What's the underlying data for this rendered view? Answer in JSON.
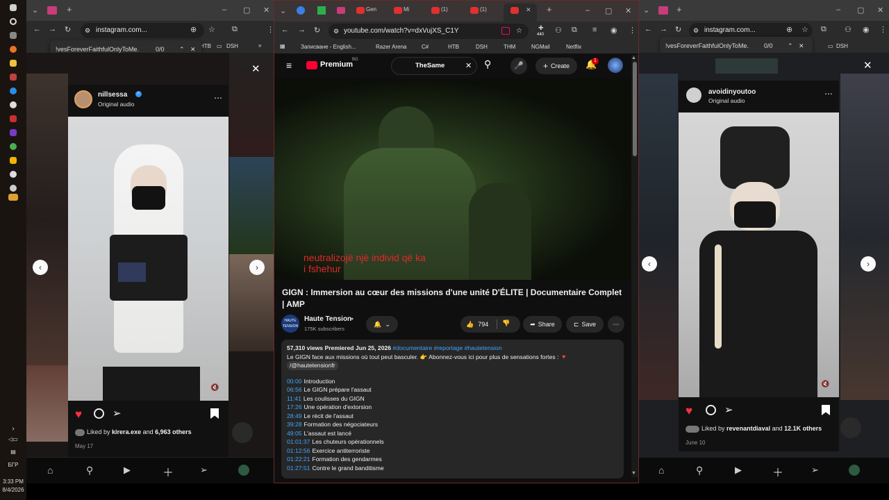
{
  "taskbar": {
    "time": "3:33 PM",
    "date": "8/4/2026",
    "language": "БГР"
  },
  "left_window": {
    "url": "instagram.com...",
    "find_query": "!vesForeverFaithfulOnlyToMe.",
    "find_count": "0/0",
    "bookmark_htb": "HTB",
    "bookmark_dsh": "DSH",
    "post": {
      "username": "nillsessa",
      "audio": "Original audio",
      "liked_by_prefix": "Liked by",
      "liked_by_user": "kirera.exe",
      "liked_by_and": "and",
      "liked_by_others": "6,963 others",
      "date": "May 17"
    }
  },
  "middle_window": {
    "url": "youtube.com/watch?v=dxVujXS_C1Y",
    "tabs": [
      "Gen",
      "Mi",
      "(1)",
      "(1)"
    ],
    "bookmarks": [
      "Записване - English...",
      "Razer Arena",
      "C#",
      "HTB",
      "DSH",
      "THM",
      "NGMail",
      "Netflix"
    ],
    "extension_badge": "440",
    "youtube": {
      "logo": "Premium",
      "logo_region": "BG",
      "search_chip": "TheSame",
      "create_label": "Create",
      "notif_count": "1",
      "subtitle_line1": "neutralizojë një individ që ka",
      "subtitle_line2": "i fshehur",
      "title": "GIGN : Immersion au cœur des missions d'une unité D'ÉLITE | Documentaire Complet | AMP",
      "channel": "Haute Tension",
      "channel_avatar_text": "HAUTE TENSION",
      "subscribers": "175K subscribers",
      "likes": "794",
      "share_label": "Share",
      "save_label": "Save",
      "views": "57,310 views",
      "premiered": "Premiered Jun 25, 2026",
      "hashtags": "#documentaire #reportage #hautetension",
      "description_line1": "Le GIGN face aux missions où tout peut basculer. 👉 Abonnez-vous ici pour plus de sensations fortes : 🔻",
      "description_line2": "/@hautetensionfr",
      "chapters": [
        {
          "time": "00:00",
          "title": "Introduction"
        },
        {
          "time": "06:56",
          "title": "Le GIGN prépare l'assaut"
        },
        {
          "time": "11:41",
          "title": "Les coulisses du GIGN"
        },
        {
          "time": "17:26",
          "title": "Une opération d'extorsion"
        },
        {
          "time": "28:49",
          "title": "Le récit de l'assaut"
        },
        {
          "time": "39:28",
          "title": "Formation des négociateurs"
        },
        {
          "time": "49:05",
          "title": "L'assaut est lancé"
        },
        {
          "time": "01:01:37",
          "title": "Les chuteurs opérationnels"
        },
        {
          "time": "01:12:56",
          "title": "Exercice antiterroriste"
        },
        {
          "time": "01:22:21",
          "title": "Formation des gendarmes"
        },
        {
          "time": "01:27:51",
          "title": "Contre le grand banditisme"
        }
      ]
    }
  },
  "right_window": {
    "url": "instagram.com...",
    "find_query": "!vesForeverFaithfulOnlyToMe.",
    "find_count": "0/0",
    "bookmark_dsh": "DSH",
    "post": {
      "username": "avoidinyoutoo",
      "audio": "Original audio",
      "liked_by_prefix": "Liked by",
      "liked_by_user": "revenantdiaval",
      "liked_by_and": "and",
      "liked_by_others": "12.1K others",
      "date": "June 10"
    }
  },
  "colors": {
    "youtube_red": "#ff0033",
    "instagram_like": "#ff3040",
    "link_blue": "#3ea6ff",
    "subtitle_red": "#e0282b"
  }
}
